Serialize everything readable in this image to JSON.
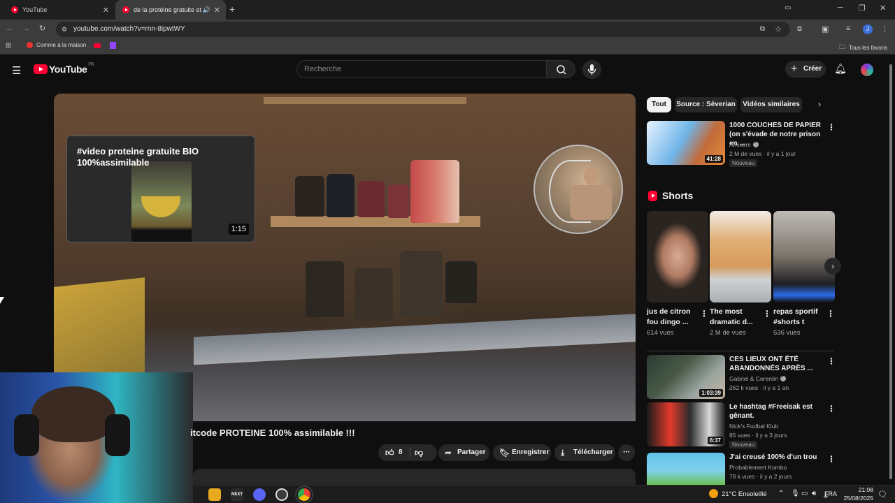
{
  "browser": {
    "tabs": [
      {
        "label": "YouTube",
        "active": false
      },
      {
        "label": "de la protéine gratuite et B",
        "active": true
      }
    ],
    "new_tab": "+",
    "url": "youtube.com/watch?v=rnn-8ipwtWY",
    "bookmarks": [
      {
        "label": "Comme à la maison"
      },
      {
        "label": ""
      },
      {
        "label": ""
      }
    ],
    "all_bookmarks": "Tous les favoris",
    "profile_initial": "J"
  },
  "header": {
    "logo_text": "YouTube",
    "logo_region": "FR",
    "search_placeholder": "Recherche",
    "create_label": "Créer"
  },
  "player": {
    "endcard": {
      "title": "#video proteine gratuite BIO 100%assimilable",
      "duration": "1:15"
    }
  },
  "video": {
    "title": "itcode PROTEINE 100% assimilable !!!",
    "likes": "8",
    "share_label": "Partager",
    "save_label": "Enregistrer",
    "download_label": "Télécharger"
  },
  "chips": [
    {
      "label": "Tout",
      "selected": true
    },
    {
      "label": "Source : Séverian",
      "selected": false
    },
    {
      "label": "Vidéos similaires",
      "selected": false
    }
  ],
  "recommendations_top": [
    {
      "title": "1000 COUCHES DE PAPIER (on s'évade de notre prison en ...",
      "channel": "Amixem",
      "verified": true,
      "meta": "2 M de vues · il y a 1 jour",
      "badge": "Nouveau",
      "duration": "41:28"
    }
  ],
  "shorts": {
    "heading": "Shorts",
    "items": [
      {
        "title": "jus de citron fou dingo ...",
        "views": "614 vues"
      },
      {
        "title": "The most dramatic d...",
        "views": "2 M de vues"
      },
      {
        "title": "repas sportif #shorts t",
        "views": "536 vues"
      }
    ]
  },
  "recommendations_bottom": [
    {
      "title": "CES LIEUX ONT ÉTÉ ABANDONNÉS APRÈS ...",
      "channel": "Gabriel & Corentin",
      "verified": true,
      "meta": "262 k vues · il y a 1 an",
      "badge": "",
      "duration": "1:03:39"
    },
    {
      "title": "Le hashtag #Freeisak est gênant.",
      "channel": "Nick's Fudbal Klub",
      "verified": false,
      "meta": "85 vues · il y a 3 jours",
      "badge": "Nouveau",
      "duration": "6:37"
    },
    {
      "title": "J'ai creusé 100% d'un trou",
      "channel": "Probablement Kombo",
      "verified": false,
      "meta": "78 k vues · il y a 2 jours",
      "badge": "",
      "duration": ""
    }
  ],
  "taskbar": {
    "weather": "21°C  Ensoleillé",
    "language": "FRA",
    "time": "21:08",
    "date": "25/08/2025"
  },
  "colors": {
    "yt_red": "#ff0033",
    "background": "#0f0f0f",
    "chip_bg": "#272727"
  }
}
